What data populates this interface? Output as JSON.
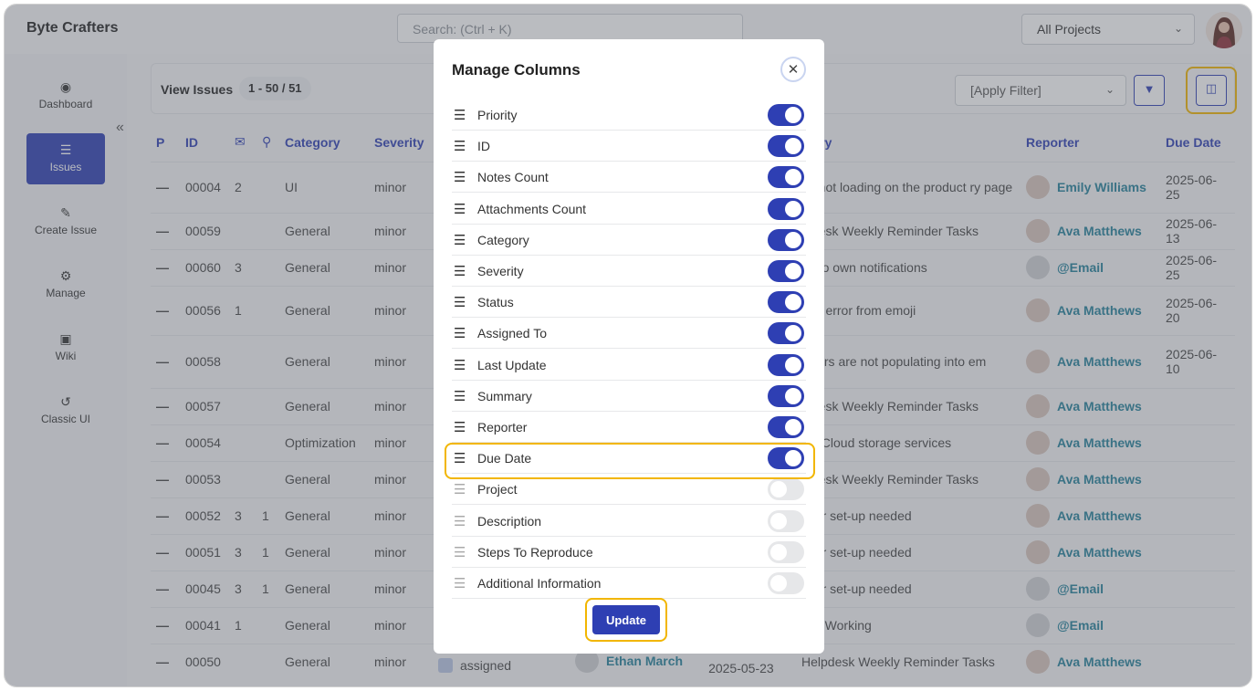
{
  "app": {
    "brand": "Byte Crafters"
  },
  "header": {
    "search_placeholder": "Search: (Ctrl + K)",
    "project_select": "All Projects"
  },
  "sidebar": {
    "items": [
      {
        "label": "Dashboard",
        "icon": "globe-icon",
        "active": false
      },
      {
        "label": "Issues",
        "icon": "list-icon",
        "active": true
      },
      {
        "label": "Create Issue",
        "icon": "edit-icon",
        "active": false
      },
      {
        "label": "Manage",
        "icon": "gears-icon",
        "active": false
      },
      {
        "label": "Wiki",
        "icon": "document-icon",
        "active": false
      },
      {
        "label": "Classic UI",
        "icon": "history-icon",
        "active": false
      }
    ]
  },
  "view": {
    "title": "View Issues",
    "range": "1 - 50 / 51",
    "filter_select": "[Apply Filter]"
  },
  "table": {
    "headers": {
      "p": "P",
      "id": "ID",
      "category": "Category",
      "severity": "Severity",
      "summary": "mary",
      "reporter": "Reporter",
      "due": "Due Date"
    },
    "rows": [
      {
        "p": "—",
        "id": "00004",
        "notes": "2",
        "attach": "",
        "category": "UI",
        "severity": "minor",
        "summary": "es not loading on the product ry page",
        "reporter": "Emily Williams",
        "due": "2025-06-25",
        "due_status": "normal"
      },
      {
        "p": "—",
        "id": "00059",
        "notes": "",
        "attach": "",
        "category": "General",
        "severity": "minor",
        "summary": "lpdesk Weekly Reminder Tasks",
        "reporter": "Ava Matthews",
        "due": "2025-06-13",
        "due_status": "overdue"
      },
      {
        "p": "—",
        "id": "00060",
        "notes": "3",
        "attach": "",
        "category": "General",
        "severity": "minor",
        "summary": "es to own notifications",
        "reporter": "@Email",
        "due": "2025-06-25",
        "due_status": "normal"
      },
      {
        "p": "—",
        "id": "00056",
        "notes": "1",
        "attach": "",
        "category": "General",
        "severity": "minor",
        "summary": "eric error from emoji",
        "reporter": "Ava Matthews",
        "due": "2025-06-20",
        "due_status": "soon"
      },
      {
        "p": "—",
        "id": "00058",
        "notes": "",
        "attach": "",
        "category": "General",
        "severity": "minor",
        "summary": "Users are not populating into em",
        "reporter": "Ava Matthews",
        "due": "2025-06-10",
        "due_status": "overdue"
      },
      {
        "p": "—",
        "id": "00057",
        "notes": "",
        "attach": "",
        "category": "General",
        "severity": "minor",
        "summary": "lpdesk Weekly Reminder Tasks",
        "reporter": "Ava Matthews",
        "due": "",
        "due_status": "normal"
      },
      {
        "p": "—",
        "id": "00054",
        "notes": "",
        "attach": "",
        "category": "Optimization",
        "severity": "minor",
        "summary": "ew Cloud storage services",
        "reporter": "Ava Matthews",
        "due": "",
        "due_status": "normal"
      },
      {
        "p": "—",
        "id": "00053",
        "notes": "",
        "attach": "",
        "category": "General",
        "severity": "minor",
        "summary": "lpdesk Weekly Reminder Tasks",
        "reporter": "Ava Matthews",
        "due": "",
        "due_status": "normal"
      },
      {
        "p": "—",
        "id": "00052",
        "notes": "3",
        "attach": "1",
        "category": "General",
        "severity": "minor",
        "summary": "user set-up needed",
        "reporter": "Ava Matthews",
        "due": "",
        "due_status": "normal"
      },
      {
        "p": "—",
        "id": "00051",
        "notes": "3",
        "attach": "1",
        "category": "General",
        "severity": "minor",
        "summary": "user set-up needed",
        "reporter": "Ava Matthews",
        "due": "",
        "due_status": "normal"
      },
      {
        "p": "—",
        "id": "00045",
        "notes": "3",
        "attach": "1",
        "category": "General",
        "severity": "minor",
        "summary": "user set-up needed",
        "reporter": "@Email",
        "due": "",
        "due_status": "normal"
      },
      {
        "p": "—",
        "id": "00041",
        "notes": "1",
        "attach": "",
        "category": "General",
        "severity": "minor",
        "summary": "Not Working",
        "reporter": "@Email",
        "due": "",
        "due_status": "normal"
      },
      {
        "p": "—",
        "id": "00050",
        "notes": "",
        "attach": "",
        "category": "General",
        "severity": "minor",
        "status": "assigned",
        "assigned": "Ethan March",
        "updated": "2025-05-23",
        "summary": "Helpdesk Weekly Reminder Tasks",
        "reporter": "Ava Matthews",
        "due": "",
        "due_status": "normal"
      }
    ]
  },
  "modal": {
    "title": "Manage Columns",
    "update_label": "Update",
    "columns": [
      {
        "label": "Priority",
        "enabled": true
      },
      {
        "label": "ID",
        "enabled": true
      },
      {
        "label": "Notes Count",
        "enabled": true
      },
      {
        "label": "Attachments Count",
        "enabled": true
      },
      {
        "label": "Category",
        "enabled": true
      },
      {
        "label": "Severity",
        "enabled": true
      },
      {
        "label": "Status",
        "enabled": true
      },
      {
        "label": "Assigned To",
        "enabled": true
      },
      {
        "label": "Last Update",
        "enabled": true
      },
      {
        "label": "Summary",
        "enabled": true
      },
      {
        "label": "Reporter",
        "enabled": true
      },
      {
        "label": "Due Date",
        "enabled": true
      },
      {
        "label": "Project",
        "enabled": false
      },
      {
        "label": "Description",
        "enabled": false
      },
      {
        "label": "Steps To Reproduce",
        "enabled": false
      },
      {
        "label": "Additional Information",
        "enabled": false
      }
    ]
  },
  "colors": {
    "accent": "#2e3fb3",
    "highlight": "#f2b600",
    "link": "#23809a",
    "overdue": "#d11b1b",
    "soon": "#e38a00"
  }
}
